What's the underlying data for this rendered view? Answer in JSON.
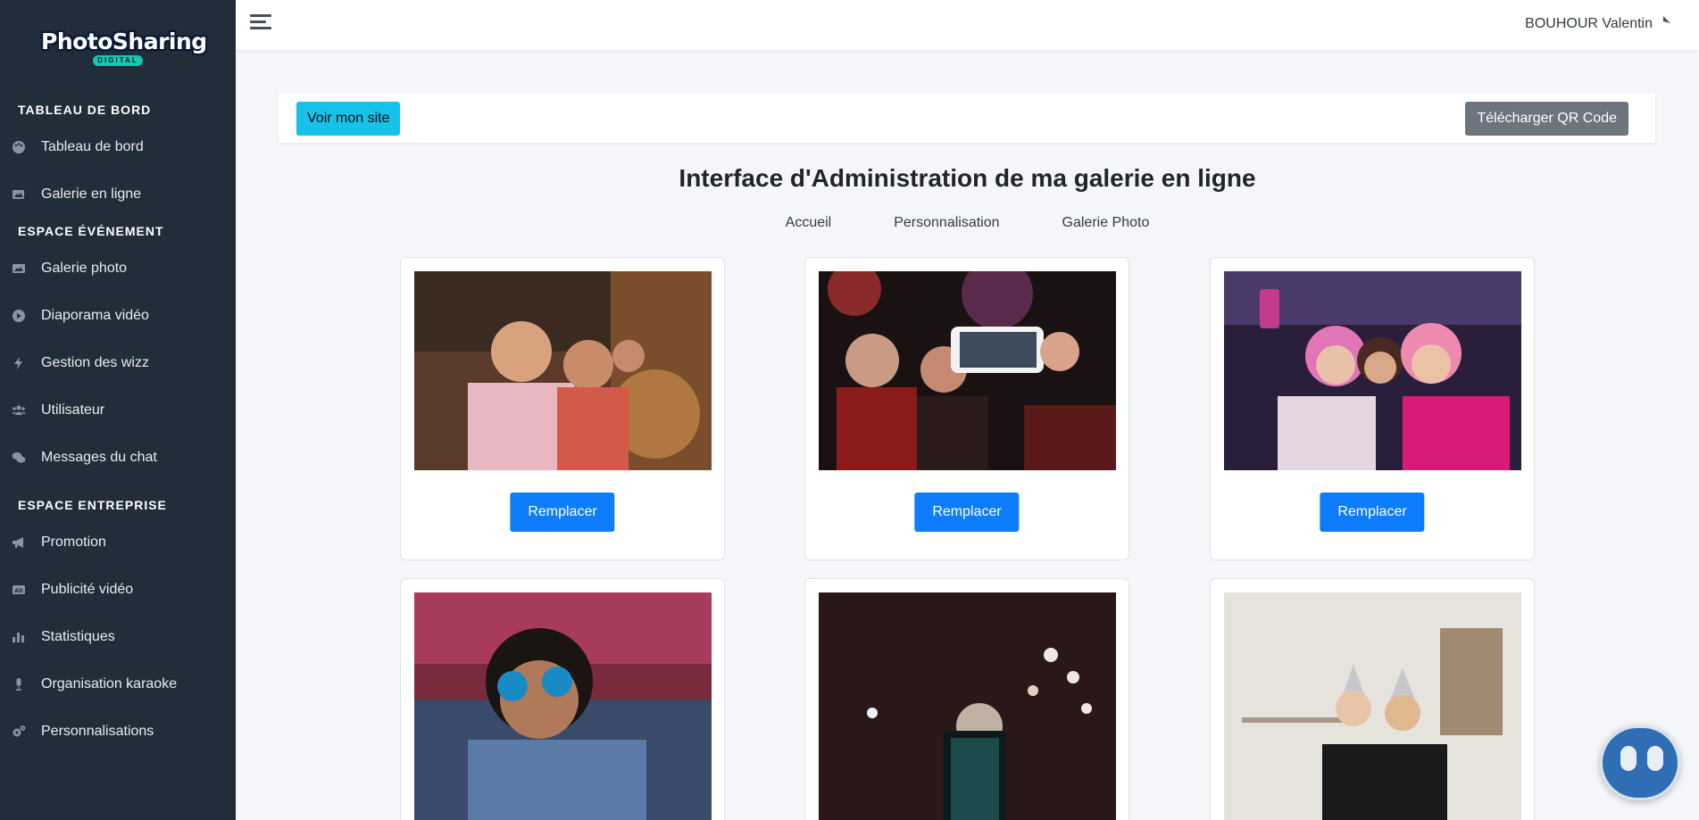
{
  "brand": {
    "name": "PhotoSharing",
    "badge": "DIGITAL"
  },
  "sidebar": {
    "sections": [
      {
        "title": "TABLEAU DE BORD",
        "items": [
          {
            "label": "Tableau de bord",
            "icon": "palette-icon"
          },
          {
            "label": "Galerie en ligne",
            "icon": "images-icon"
          }
        ]
      },
      {
        "title": "ESPACE ÉVÉNEMENT",
        "items": [
          {
            "label": "Galerie photo",
            "icon": "image-icon"
          },
          {
            "label": "Diaporama vidéo",
            "icon": "play-circle-icon"
          },
          {
            "label": "Gestion des wizz",
            "icon": "bolt-icon"
          },
          {
            "label": "Utilisateur",
            "icon": "users-icon"
          },
          {
            "label": "Messages du chat",
            "icon": "comments-icon"
          }
        ]
      },
      {
        "title": "ESPACE ENTREPRISE",
        "items": [
          {
            "label": "Promotion",
            "icon": "bullhorn-icon"
          },
          {
            "label": "Publicité vidéo",
            "icon": "ad-icon"
          },
          {
            "label": "Statistiques",
            "icon": "bar-chart-icon"
          },
          {
            "label": "Organisation karaoke",
            "icon": "microphone-icon"
          },
          {
            "label": "Personnalisations",
            "icon": "cogs-icon"
          }
        ]
      }
    ]
  },
  "topbar": {
    "user_name": "BOUHOUR Valentin"
  },
  "actions": {
    "view_site": "Voir mon site",
    "download_qr": "Télécharger QR Code"
  },
  "main": {
    "title": "Interface d'Administration de ma galerie en ligne",
    "tabs": [
      "Accueil",
      "Personnalisation",
      "Galerie Photo"
    ]
  },
  "gallery": {
    "replace_label": "Remplacer",
    "photos": [
      {
        "subject": "group selfie in bar"
      },
      {
        "subject": "phone selfie at party"
      },
      {
        "subject": "women selfie at concert"
      },
      {
        "subject": "man with blue sunglasses"
      },
      {
        "subject": "phone filming sparklers"
      },
      {
        "subject": "women with party hats"
      }
    ]
  },
  "colors": {
    "sidebar_bg": "#222d3a",
    "primary": "#0d7dfc",
    "info": "#17c1e8",
    "secondary": "#6c757d"
  }
}
